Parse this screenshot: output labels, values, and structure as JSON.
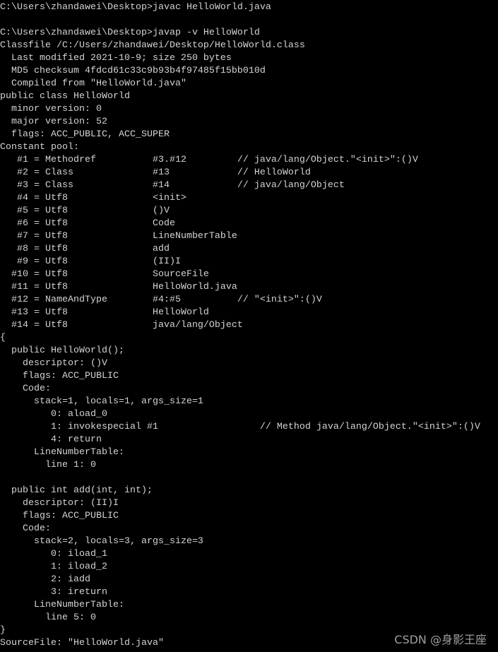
{
  "terminal": {
    "colors": {
      "background": "#000000",
      "text": "#d4d4d4"
    },
    "lines": [
      "C:\\Users\\zhandawei\\Desktop>javac HelloWorld.java",
      "",
      "C:\\Users\\zhandawei\\Desktop>javap -v HelloWorld",
      "Classfile /C:/Users/zhandawei/Desktop/HelloWorld.class",
      "  Last modified 2021-10-9; size 250 bytes",
      "  MD5 checksum 4fdcd61c33c9b93b4f97485f15bb010d",
      "  Compiled from \"HelloWorld.java\"",
      "public class HelloWorld",
      "  minor version: 0",
      "  major version: 52",
      "  flags: ACC_PUBLIC, ACC_SUPER",
      "Constant pool:",
      "   #1 = Methodref          #3.#12         // java/lang/Object.\"<init>\":()V",
      "   #2 = Class              #13            // HelloWorld",
      "   #3 = Class              #14            // java/lang/Object",
      "   #4 = Utf8               <init>",
      "   #5 = Utf8               ()V",
      "   #6 = Utf8               Code",
      "   #7 = Utf8               LineNumberTable",
      "   #8 = Utf8               add",
      "   #9 = Utf8               (II)I",
      "  #10 = Utf8               SourceFile",
      "  #11 = Utf8               HelloWorld.java",
      "  #12 = NameAndType        #4:#5          // \"<init>\":()V",
      "  #13 = Utf8               HelloWorld",
      "  #14 = Utf8               java/lang/Object",
      "{",
      "  public HelloWorld();",
      "    descriptor: ()V",
      "    flags: ACC_PUBLIC",
      "    Code:",
      "      stack=1, locals=1, args_size=1",
      "         0: aload_0",
      "         1: invokespecial #1                  // Method java/lang/Object.\"<init>\":()V",
      "         4: return",
      "      LineNumberTable:",
      "        line 1: 0",
      "",
      "  public int add(int, int);",
      "    descriptor: (II)I",
      "    flags: ACC_PUBLIC",
      "    Code:",
      "      stack=2, locals=3, args_size=3",
      "         0: iload_1",
      "         1: iload_2",
      "         2: iadd",
      "         3: ireturn",
      "      LineNumberTable:",
      "        line 5: 0",
      "}",
      "SourceFile: \"HelloWorld.java\""
    ]
  },
  "watermark": "CSDN @身影王座"
}
